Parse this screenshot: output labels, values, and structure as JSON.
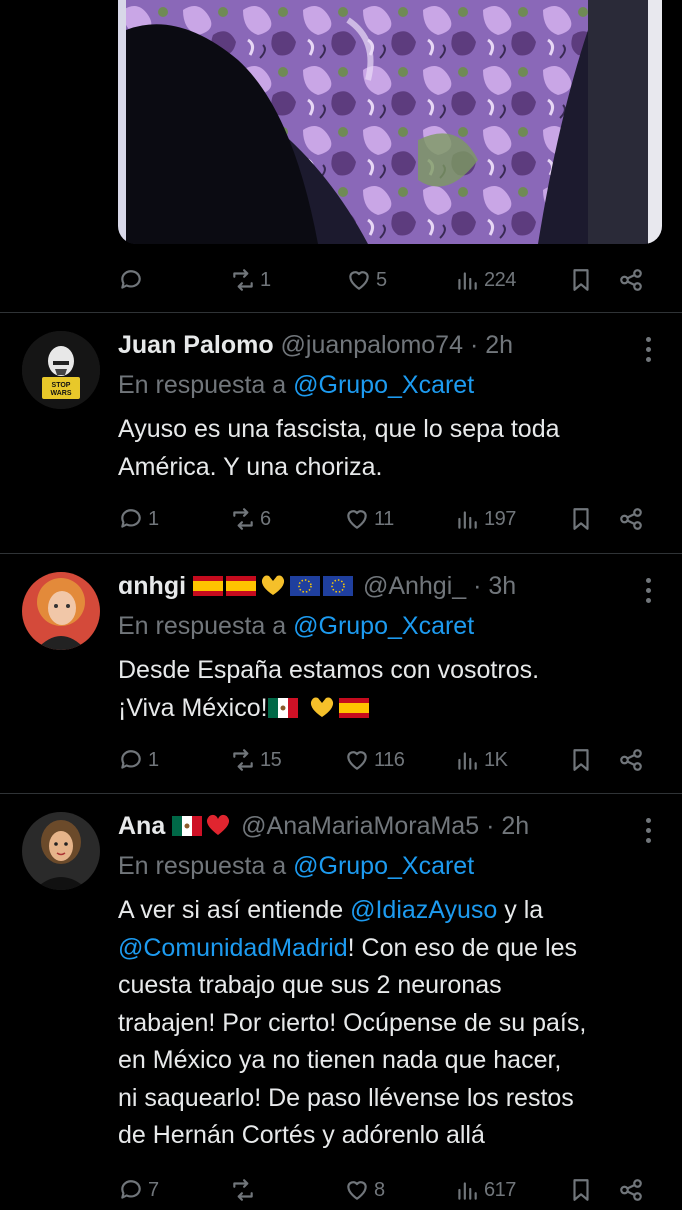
{
  "top_tweet": {
    "media_alt": "",
    "stats": {
      "replies": "",
      "retweets": "1",
      "likes": "5",
      "views": "224"
    }
  },
  "tweets": [
    {
      "name": "Juan Palomo",
      "handle": "@juanpalomo74",
      "time": "· 2h",
      "reply_prefix": "En respuesta a",
      "reply_to": "@Grupo_Xcaret",
      "avatar_badge": "STOP WARS",
      "text_lines": [
        "Ayuso es una fascista, que lo sepa toda",
        "América. Y una choriza."
      ],
      "stats": {
        "replies": "1",
        "retweets": "6",
        "likes": "11",
        "views": "197"
      }
    },
    {
      "name": "ɑnhgi",
      "handle": "@Anhgi_",
      "time": "· 3h",
      "reply_prefix": "En respuesta a",
      "reply_to": "@Grupo_Xcaret",
      "text_line1": "Desde España estamos con vosotros.",
      "text_line2": "¡Viva México!",
      "stats": {
        "replies": "1",
        "retweets": "15",
        "likes": "116",
        "views": "1K"
      }
    },
    {
      "name": "Ana",
      "handle": "@AnaMariaMoraMa5",
      "time": "· 2h",
      "reply_prefix": "En respuesta a",
      "reply_to": "@Grupo_Xcaret",
      "line1_pre": "A ver si así entiende ",
      "line1_mention": "@IdiazAyuso",
      "line1_post": " y la",
      "line2_mention": "@ComunidadMadrid",
      "line2_post": "! Con eso de que les",
      "text_lines": [
        "cuesta trabajo que sus 2 neuronas",
        "trabajen! Por cierto! Ocúpense de su país,",
        "en México ya no tienen nada que hacer,",
        "ni saquearlo! De paso llévense los restos",
        "de Hernán Cortés y adórenlo allá"
      ],
      "stats": {
        "replies": "7",
        "retweets": "",
        "likes": "8",
        "views": "617"
      }
    }
  ],
  "colors": {
    "background": "#000000",
    "text": "#e7e9ea",
    "muted": "#71767b",
    "link": "#1d9bf0",
    "divider": "#2f3336"
  }
}
